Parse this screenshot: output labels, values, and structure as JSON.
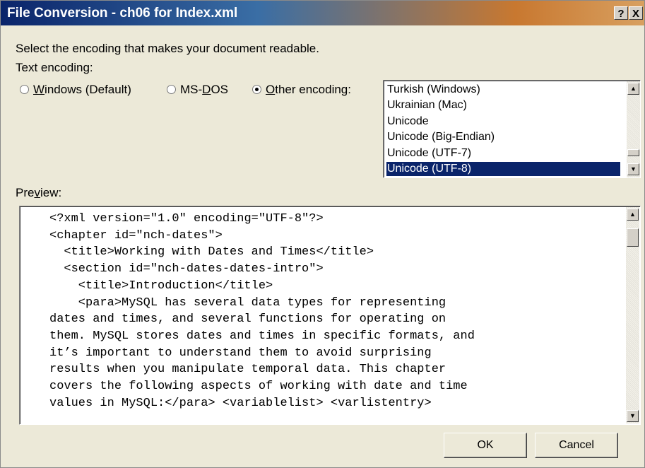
{
  "window": {
    "title": "File Conversion - ch06 for Index.xml",
    "help_label": "?",
    "close_label": "X"
  },
  "instructions": "Select the encoding that makes your document readable.",
  "encoding": {
    "label": "Text encoding:",
    "options": [
      {
        "accel": "W",
        "rest": "indows (Default)",
        "checked": false
      },
      {
        "pre": "MS-",
        "accel": "D",
        "rest": "OS",
        "checked": false
      },
      {
        "accel": "O",
        "rest": "ther encoding:",
        "checked": true
      }
    ],
    "list_items": [
      "Turkish (Windows)",
      "Ukrainian (Mac)",
      "Unicode",
      "Unicode (Big-Endian)",
      "Unicode (UTF-7)",
      "Unicode (UTF-8)"
    ],
    "selected_item": "Unicode (UTF-8)"
  },
  "preview": {
    "label_pre": "Pre",
    "label_accel": "v",
    "label_post": "iew:",
    "lines": [
      "<?xml version=\"1.0\" encoding=\"UTF-8\"?>",
      "<chapter id=\"nch-dates\">",
      "  <title>Working with Dates and Times</title>",
      "  <section id=\"nch-dates-dates-intro\">",
      "    <title>Introduction</title>",
      "    <para>MySQL has several data types for representing",
      "dates and times, and several functions for operating on",
      "them. MySQL stores dates and times in specific formats, and",
      "it’s important to understand them to avoid surprising",
      "results when you manipulate temporal data. This chapter",
      "covers the following aspects of working with date and time",
      "values in MySQL:</para> <variablelist> <varlistentry>"
    ]
  },
  "buttons": {
    "ok": "OK",
    "cancel": "Cancel"
  }
}
